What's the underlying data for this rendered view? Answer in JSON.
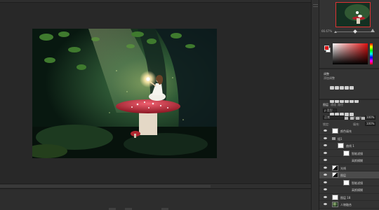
{
  "navigator": {
    "zoom": "66.67%"
  },
  "color_panel": {
    "foreground": "#e01515",
    "background": "#ffffff"
  },
  "adjustments": {
    "title": "调整",
    "subtitle": "添加调整"
  },
  "layers": {
    "tabs": [
      "图层",
      "通道",
      "路径"
    ],
    "kind_filter": "ρ 类型",
    "blend_mode": "正常",
    "opacity_label": "不透明度:",
    "opacity": "100%",
    "lock_label": "锁定:",
    "fill_label": "填充:",
    "fill": "100%",
    "rows": [
      {
        "name": "颜色填充",
        "indent": 0,
        "thumb": "white",
        "selected": false
      },
      {
        "name": "组1",
        "indent": 0,
        "thumb": "folder",
        "selected": false
      },
      {
        "name": "曲线 1",
        "indent": 1,
        "thumb": "white",
        "selected": false
      },
      {
        "name": "智能滤镜",
        "indent": 2,
        "thumb": "white",
        "selected": false
      },
      {
        "name": "高斯模糊",
        "indent": 2,
        "thumb": "none",
        "selected": false
      },
      {
        "name": "光线",
        "indent": 0,
        "thumb": "mix",
        "selected": false
      },
      {
        "name": "图层",
        "indent": 0,
        "thumb": "mix",
        "selected": true
      },
      {
        "name": "智能滤镜",
        "indent": 2,
        "thumb": "white",
        "selected": false
      },
      {
        "name": "高斯模糊",
        "indent": 2,
        "thumb": "none",
        "selected": false
      },
      {
        "name": "图层 18",
        "indent": 0,
        "thumb": "white",
        "selected": false
      },
      {
        "name": "人物融合",
        "indent": 0,
        "thumb": "scene",
        "selected": false
      }
    ]
  },
  "colors": {
    "workspace": "#282828",
    "panel": "#333333",
    "selection": "#4b4b4b",
    "accent_red": "#d33333"
  },
  "icons": [
    "eye-icon",
    "folder-icon",
    "lock-icon",
    "mountain-small-icon",
    "mountain-large-icon"
  ]
}
